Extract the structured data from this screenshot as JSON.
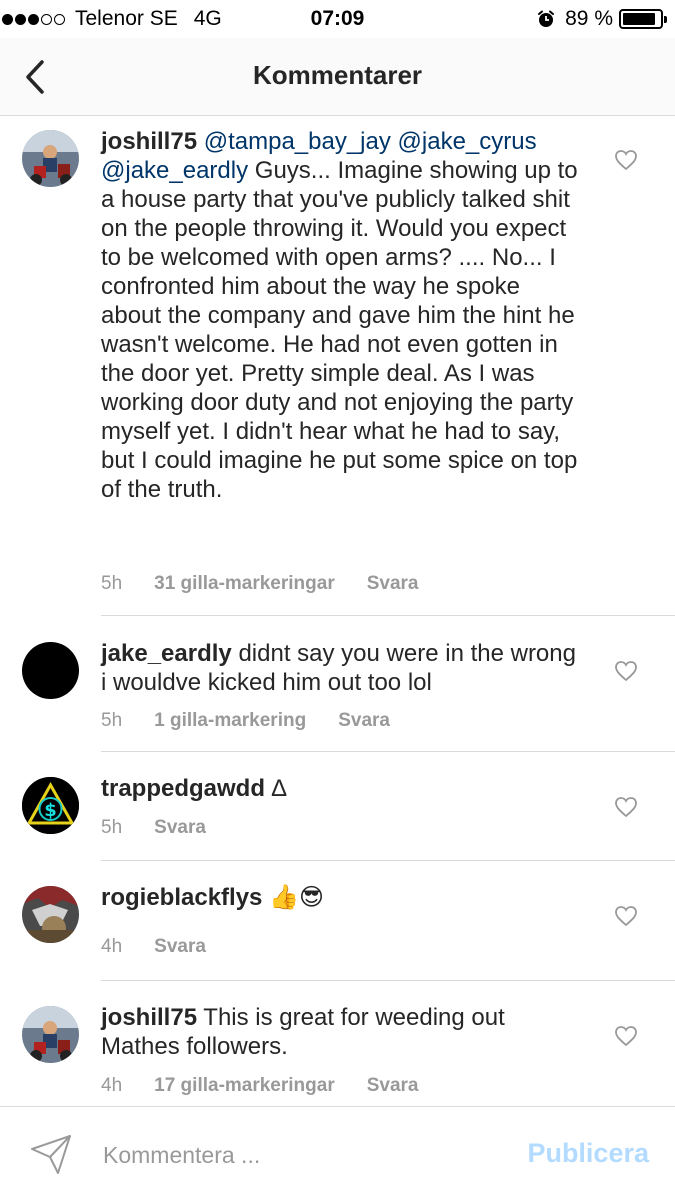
{
  "status_bar": {
    "carrier": "Telenor SE",
    "network": "4G",
    "time": "07:09",
    "battery_percent": "89 %",
    "battery_level": 0.89
  },
  "header": {
    "title": "Kommentarer",
    "back_icon": "chevron-left-icon"
  },
  "comments": [
    {
      "username": "joshill75",
      "mentions": [
        "@tampa_bay_jay",
        "@jake_cyrus",
        "@jake_eardly"
      ],
      "text": " Guys... Imagine showing up to a house party that you've publicly talked shit on the people throwing it.  Would you expect to be welcomed with open arms? .... No... I confronted him about the way he spoke about the company and gave him the hint he wasn't welcome.  He had not even gotten in the door yet.  Pretty simple deal.  As I was working door duty and not enjoying the party myself yet.  I didn't hear what he had to say,  but I could imagine he put some spice on top of the truth.",
      "time": "5h",
      "likes": "31 gilla-markeringar",
      "reply": "Svara"
    },
    {
      "username": "jake_eardly",
      "text": "didnt say you were in the wrong i wouldve kicked him out too lol",
      "time": "5h",
      "likes": "1 gilla-markering",
      "reply": "Svara"
    },
    {
      "username": "trappedgawdd",
      "text": "∆",
      "time": "5h",
      "reply": "Svara"
    },
    {
      "username": "rogieblackflys",
      "text": "👍😎",
      "time": "4h",
      "reply": "Svara"
    },
    {
      "username": "joshill75",
      "text": "This is great for weeding out Mathes followers.",
      "time": "4h",
      "likes": "17 gilla-markeringar",
      "reply": "Svara"
    }
  ],
  "input": {
    "placeholder": "Kommentera ...",
    "publish_label": "Publicera",
    "publish_color": "#b3dbff"
  },
  "colors": {
    "mention": "#003569",
    "meta": "#999999",
    "divider": "#dbdbdb"
  }
}
